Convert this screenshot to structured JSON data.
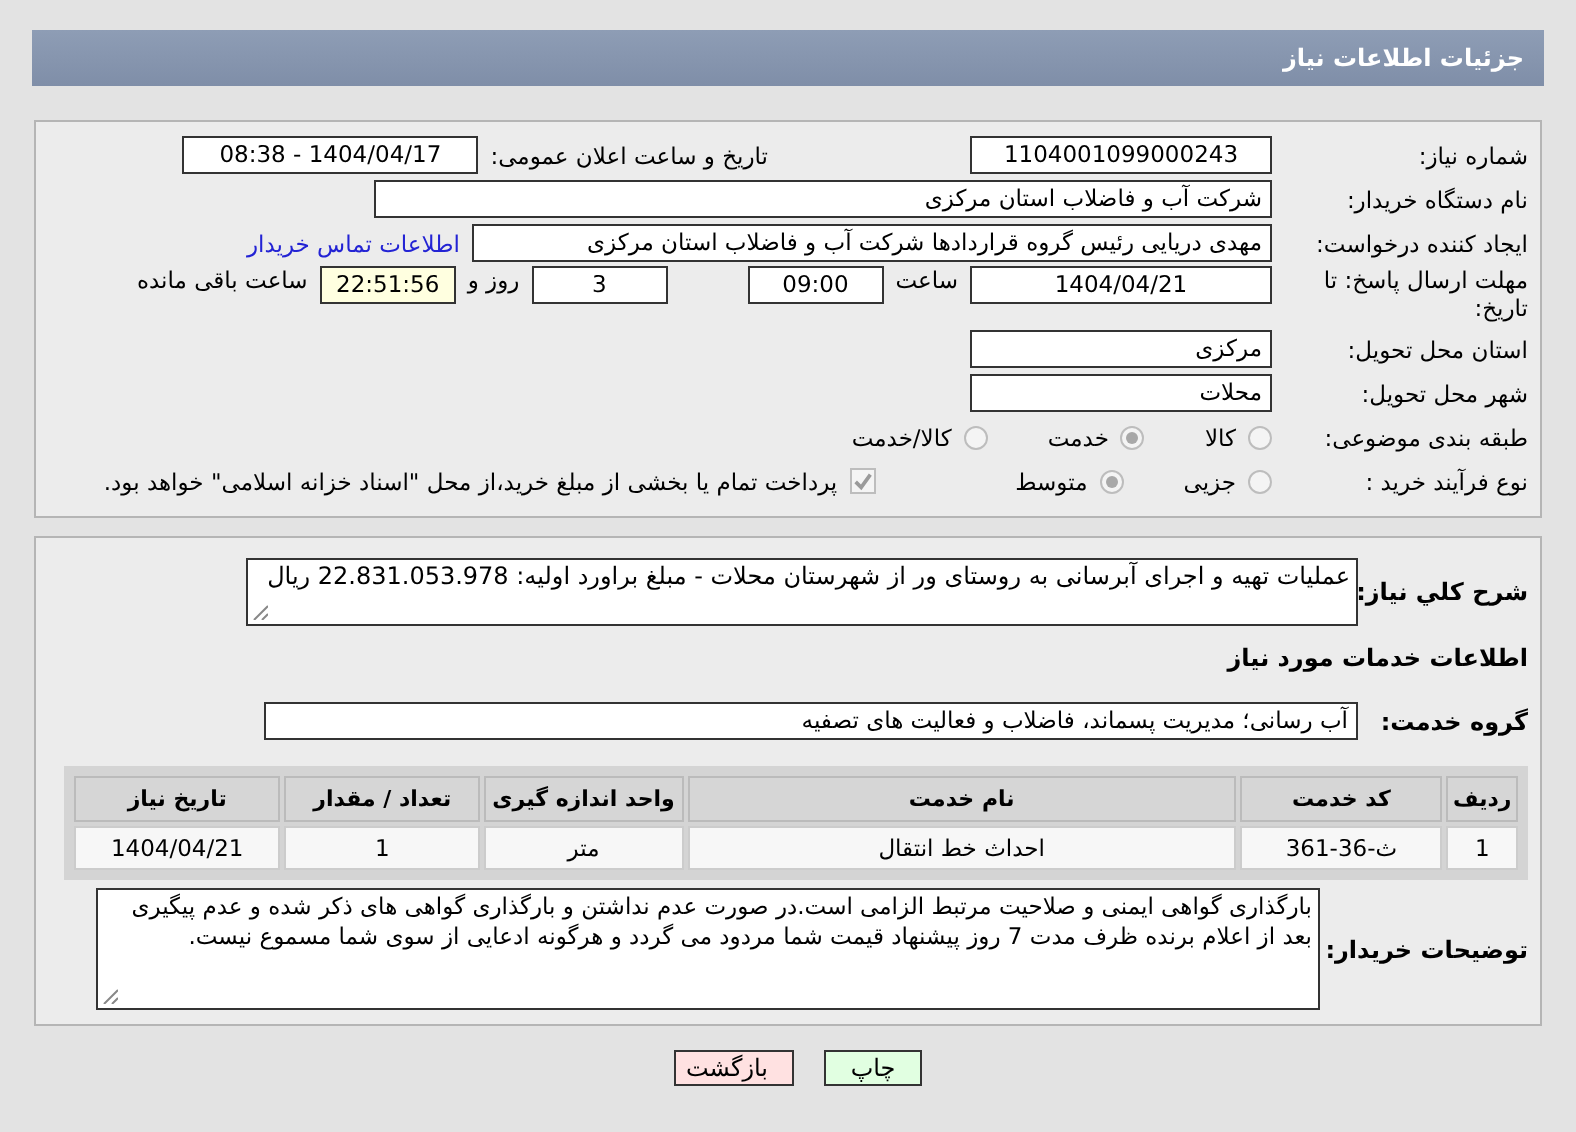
{
  "header": {
    "title": "جزئیات اطلاعات نیاز"
  },
  "need_number": {
    "label": "شماره نیاز:",
    "value": "1104001099000243"
  },
  "announce": {
    "label": "تاریخ و ساعت اعلان عمومی:",
    "value": "1404/04/17 - 08:38"
  },
  "buyer": {
    "label": "نام دستگاه خریدار:",
    "value": "شرکت آب و فاضلاب استان مرکزی"
  },
  "creator": {
    "label": "ایجاد کننده درخواست:",
    "value": "مهدی دریایی رئیس گروه قراردادها شرکت آب و فاضلاب استان مرکزی",
    "link": "اطلاعات تماس خریدار"
  },
  "deadline": {
    "label": "مهلت ارسال پاسخ: تا تاریخ:",
    "date": "1404/04/21",
    "time_label": "ساعت",
    "time": "09:00",
    "days": "3",
    "days_label": "روز و",
    "remaining": "22:51:56",
    "remaining_label": "ساعت باقی مانده"
  },
  "province": {
    "label": "استان محل تحویل:",
    "value": "مرکزی"
  },
  "city": {
    "label": "شهر محل تحویل:",
    "value": "محلات"
  },
  "category": {
    "label": "طبقه بندی موضوعی:",
    "options": [
      {
        "label": "كالا",
        "selected": false
      },
      {
        "label": "خدمت",
        "selected": true
      },
      {
        "label": "كالا/خدمت",
        "selected": false
      }
    ]
  },
  "process": {
    "label": "نوع فرآیند خرید :",
    "options": [
      {
        "label": "جزیی",
        "selected": false
      },
      {
        "label": "متوسط",
        "selected": true
      }
    ],
    "payment": {
      "label": "پرداخت تمام یا بخشی از مبلغ خرید،از محل \"اسناد خزانه اسلامی\" خواهد بود.",
      "checked": true
    }
  },
  "description": {
    "label": "شرح کلي نياز:",
    "value": "عملیات تهیه و اجرای آبرسانی به روستای ور از شهرستان محلات - مبلغ براورد اولیه: 22.831.053.978 ریال"
  },
  "services_heading": "اطلاعات خدمات مورد نياز",
  "service_group": {
    "label": "گروه خدمت:",
    "value": "آب رسانی؛ مدیریت پسماند، فاضلاب و فعالیت های تصفیه"
  },
  "table": {
    "columns": [
      "ردیف",
      "کد خدمت",
      "نام خدمت",
      "واحد اندازه گیری",
      "تعداد / مقدار",
      "تاریخ نیاز"
    ],
    "rows": [
      [
        "1",
        "ث-36-361",
        "احداث خط انتقال",
        "متر",
        "1",
        "1404/04/21"
      ]
    ]
  },
  "notes": {
    "label": "توضیحات خریدار:",
    "value": "بارگذاری گواهی ایمنی و صلاحیت مرتبط الزامی است.در صورت عدم نداشتن و بارگذاری گواهی های ذکر شده و عدم پیگیری بعد از اعلام برنده ظرف مدت 7 روز پیشنهاد قیمت شما مردود می گردد و هرگونه ادعایی از سوی شما مسموع نیست."
  },
  "buttons": [
    {
      "label": "چاپ",
      "kind": "print"
    },
    {
      "label": "بازگشت",
      "kind": "back"
    }
  ]
}
